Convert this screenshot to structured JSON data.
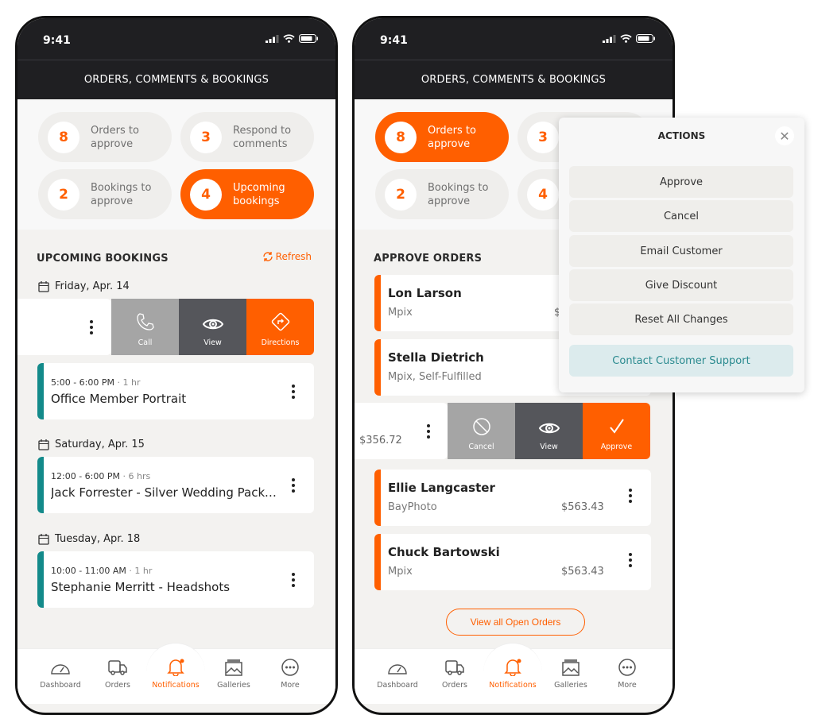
{
  "status": {
    "time": "9:41"
  },
  "header": {
    "title": "ORDERS, COMMENTS & BOOKINGS"
  },
  "summary": [
    {
      "count": "8",
      "label": "Orders to\napprove"
    },
    {
      "count": "3",
      "label": "Respond to\ncomments"
    },
    {
      "count": "2",
      "label": "Bookings to\napprove"
    },
    {
      "count": "4",
      "label": "Upcoming\nbookings"
    }
  ],
  "bookings": {
    "title": "UPCOMING BOOKINGS",
    "refresh": "Refresh",
    "swipe_actions": [
      "Call",
      "View",
      "Directions"
    ],
    "groups": [
      {
        "date": "Friday, Apr. 14",
        "time": "5:00 - 6:00 PM",
        "duration": "· 1 hr",
        "title": "Office Member Portrait"
      },
      {
        "date": "Saturday, Apr. 15",
        "time": "12:00 - 6:00 PM",
        "duration": "· 6 hrs",
        "title": "Jack Forrester - Silver Wedding Package"
      },
      {
        "date": "Tuesday, Apr. 18",
        "time": "10:00 - 11:00 AM",
        "duration": "· 1 hr",
        "title": "Stephanie Merritt - Headshots"
      }
    ]
  },
  "orders": {
    "title": "APPROVE ORDERS",
    "items": [
      {
        "name": "Lon Larson",
        "lab": "Mpix",
        "price": "$"
      },
      {
        "name": "Stella Dietrich",
        "lab": "Mpix, Self-Fulfilled"
      },
      {
        "name": "Ellie Langcaster",
        "lab": "BayPhoto",
        "price": "$563.43"
      },
      {
        "name": "Chuck Bartowski",
        "lab": "Mpix",
        "price": "$563.43"
      }
    ],
    "swiped_price": "$356.72",
    "swipe_actions": [
      "Cancel",
      "View",
      "Approve"
    ],
    "view_all": "View all Open Orders"
  },
  "actions": {
    "title": "ACTIONS",
    "close": "✕",
    "buttons": [
      "Approve",
      "Cancel",
      "Email Customer",
      "Give Discount",
      "Reset All Changes"
    ],
    "support": "Contact Customer Support"
  },
  "nav": [
    "Dashboard",
    "Orders",
    "Notifications",
    "Galleries",
    "More"
  ],
  "colors": {
    "accent": "#ff5f00",
    "teal": "#138a8a",
    "dark": "#1f1f22"
  }
}
